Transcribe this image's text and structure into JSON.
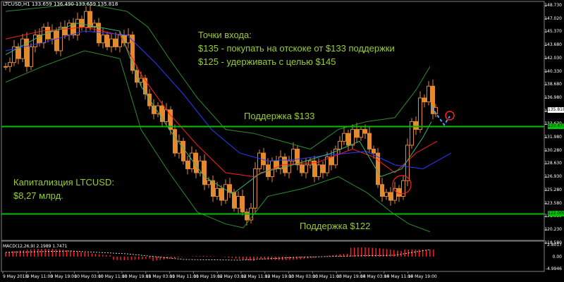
{
  "header": {
    "ohlc_line": "LTCUSD,H1  133.659 136.490 133.659 135.818"
  },
  "macd": {
    "label": "MACD(12,26,9) 2.1989 1.7471",
    "top": "2.8017",
    "zero": "0.00",
    "bottom": "-4.9946"
  },
  "annotations": {
    "entry": [
      "Точки входа:",
      "$135 - покупать на отскоке от $133 поддержки",
      "$125 - удерживать с целью $145"
    ],
    "support_upper": "Поддержка $133",
    "support_lower": "Поддержка $122",
    "cap_title": "Капитализция LTCUSD:",
    "cap_value": "$8,27 млрд."
  },
  "price_axis": [
    "148.730",
    "147.020",
    "145.370",
    "143.680",
    "142.030",
    "140.330",
    "138.680",
    "136.980",
    "135.330",
    "133.630",
    "131.980",
    "130.280",
    "128.630",
    "126.930",
    "125.280",
    "123.580",
    "121.930",
    "120.230",
    "118.580"
  ],
  "price_tags": {
    "current": "135.818",
    "upper_line": "133.473",
    "lower_line": "122.009"
  },
  "time_axis": [
    "9 May 2018",
    "9 May 11:00",
    "9 May 19:00",
    "10 May 03:00",
    "10 May 11:00",
    "10 May 19:00",
    "11 May 03:00",
    "11 May 11:00",
    "11 May 19:00",
    "12 May 03:00",
    "12 May 11:00",
    "12 May 19:00",
    "13 May 03:00",
    "13 May 11:00",
    "13 May 19:00",
    "14 May 03:00",
    "14 May 11:00",
    "14 May 19:00"
  ],
  "colors": {
    "background": "#000000",
    "candle": "#e38a2e",
    "support_line": "#00c000",
    "annotation": "#9acd32",
    "macd": "#ff2020",
    "bollinger": "#2e8b2e",
    "ma_fast": "#ff2020",
    "ma_slow": "#2a3cff",
    "ma_green": "#3cb371"
  }
}
